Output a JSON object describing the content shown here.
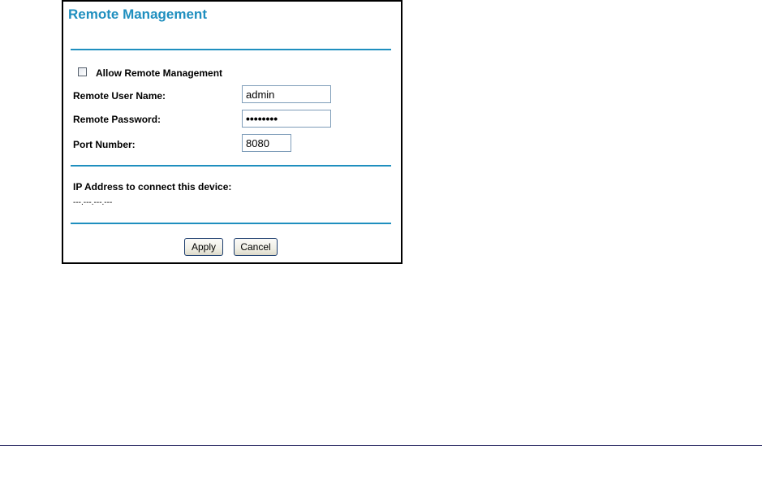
{
  "panel": {
    "title": "Remote Management"
  },
  "remote": {
    "allow_label": "Allow Remote Management",
    "allow_checked": false,
    "username_label": "Remote User Name:",
    "username_value": "admin",
    "password_label": "Remote Password:",
    "password_value": "••••••••",
    "port_label": "Port Number:",
    "port_value": "8080"
  },
  "ip": {
    "label": "IP Address to connect this device:",
    "value": "---.---.---.---"
  },
  "actions": {
    "apply_label": "Apply",
    "cancel_label": "Cancel"
  },
  "colors": {
    "accent": "#1f8fbf",
    "panel_border": "#000000",
    "page_rule": "#33336a"
  }
}
